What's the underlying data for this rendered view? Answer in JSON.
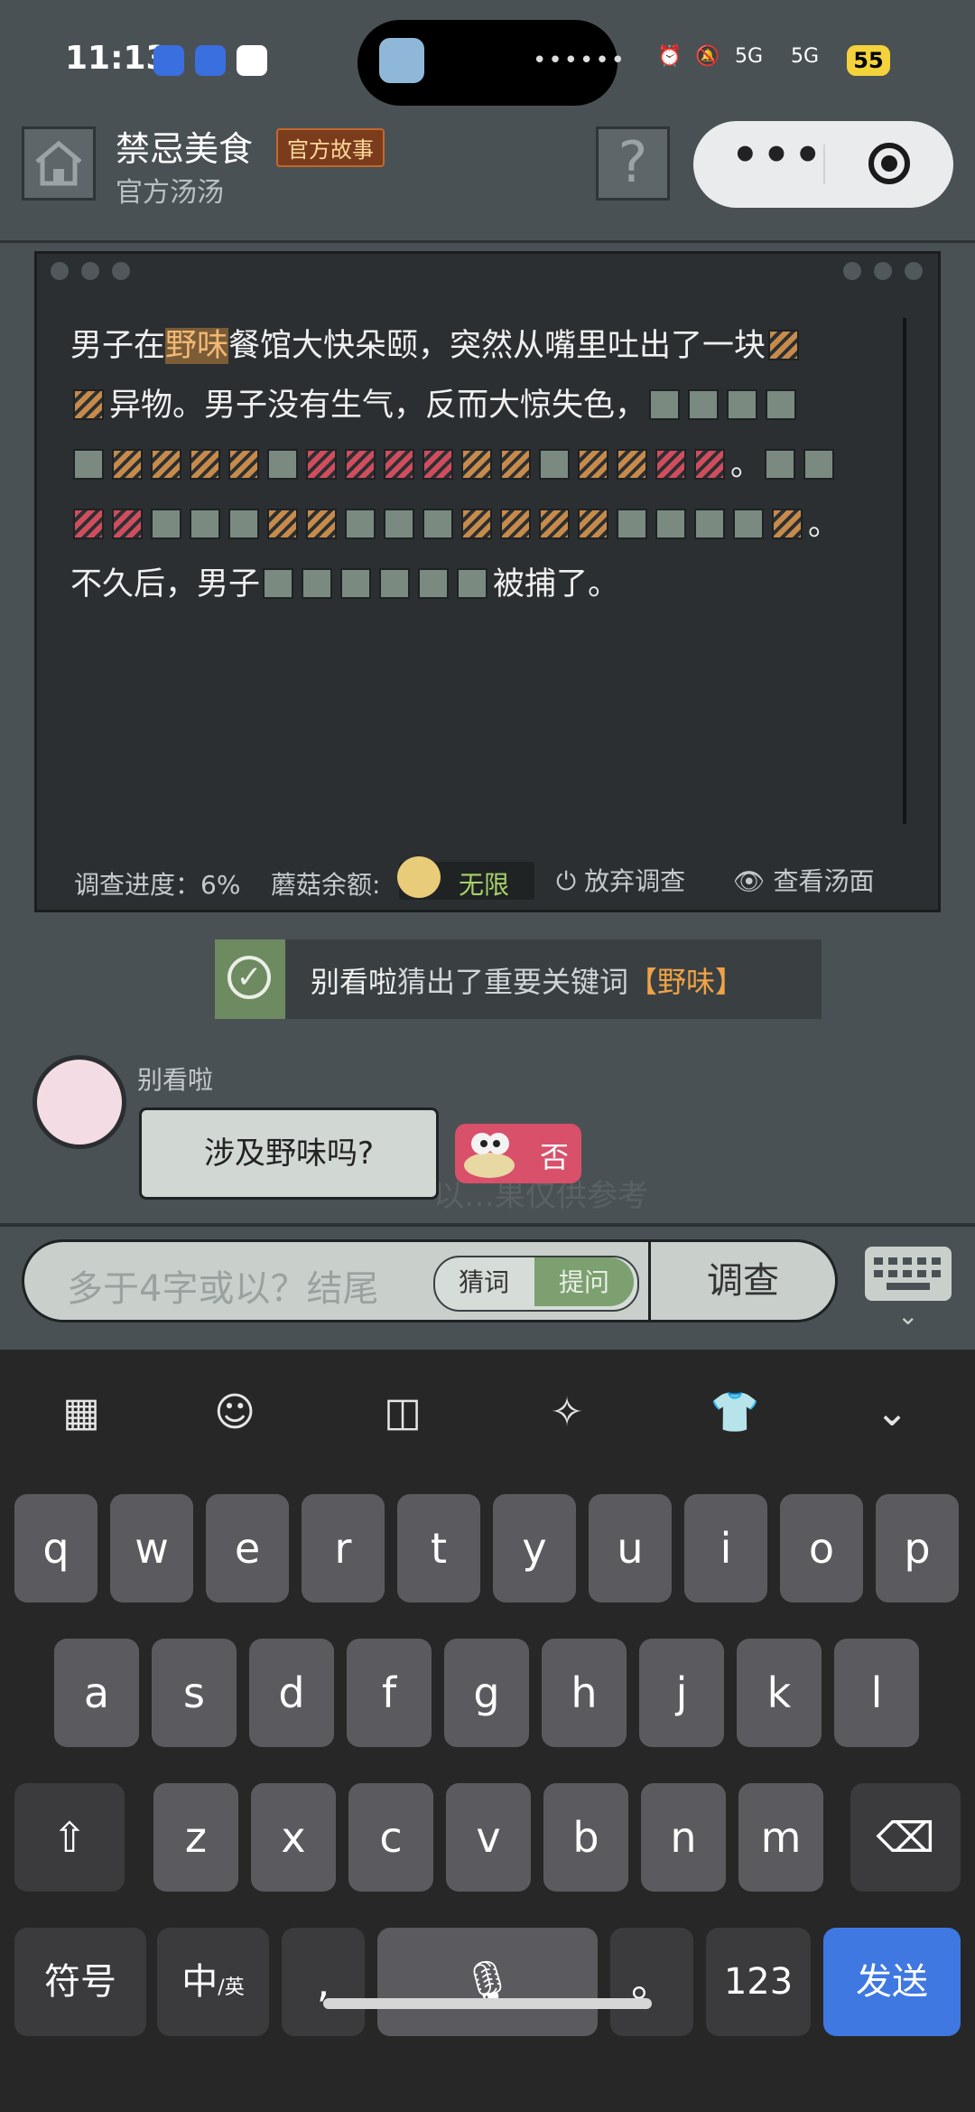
{
  "status_bar": {
    "time": "11:13",
    "battery": "55",
    "signal_left": "5G",
    "signal_right": "5G"
  },
  "header": {
    "title": "禁忌美食",
    "badge": "官方故事",
    "subtitle": "官方汤汤",
    "help": "?"
  },
  "story": {
    "line1_a": "男子在",
    "line1_hl": "野味",
    "line1_b": "餐馆大快朵颐，突然从嘴里吐出了一块",
    "line2_a": "异物。男子没有生气，反而大惊失色，",
    "line3_end": "。",
    "line4_end": "。",
    "line5_a": "不久后，男子",
    "line5_b": "被捕了。"
  },
  "footer": {
    "progress": "调查进度：6%",
    "mushroom_label": "蘑菇余额:",
    "mushroom_value": "无限",
    "quit": "放弃调查",
    "view": "查看汤面"
  },
  "system_message": {
    "user": "别看啦",
    "text": "猜出了重要关键词",
    "keyword": "【野味】"
  },
  "chat": {
    "username": "别看啦",
    "question": "涉及野味吗?",
    "background_hint": "以…果仅供参考",
    "answer": "否"
  },
  "input": {
    "placeholder": "多于4字或以？结尾",
    "toggle_guess": "猜词",
    "toggle_ask": "提问",
    "submit": "调查"
  },
  "keyboard": {
    "row1": [
      "q",
      "w",
      "e",
      "r",
      "t",
      "y",
      "u",
      "i",
      "o",
      "p"
    ],
    "row2": [
      "a",
      "s",
      "d",
      "f",
      "g",
      "h",
      "j",
      "k",
      "l"
    ],
    "row3": [
      "z",
      "x",
      "c",
      "v",
      "b",
      "n",
      "m"
    ],
    "symbols": "符号",
    "lang": "中",
    "lang_sub": "/英",
    "comma": ",",
    "period": "。",
    "numbers": "123",
    "send": "发送"
  }
}
